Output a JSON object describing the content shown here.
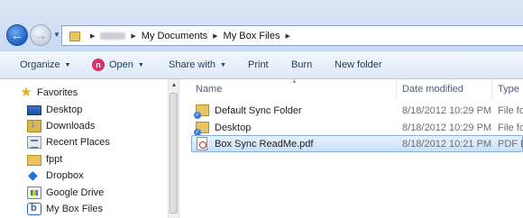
{
  "address": {
    "breadcrumbs": [
      "My Documents",
      "My Box Files"
    ]
  },
  "toolbar": {
    "organize": "Organize",
    "open": "Open",
    "share_with": "Share with",
    "print": "Print",
    "burn": "Burn",
    "new_folder": "New folder"
  },
  "nav": {
    "favorites": "Favorites",
    "items": [
      {
        "label": "Desktop",
        "icon": "desktop-icon"
      },
      {
        "label": "Downloads",
        "icon": "downloads-icon"
      },
      {
        "label": "Recent Places",
        "icon": "recent-places-icon"
      },
      {
        "label": "fppt",
        "icon": "folder-icon"
      },
      {
        "label": "Dropbox",
        "icon": "dropbox-icon"
      },
      {
        "label": "Google Drive",
        "icon": "google-drive-icon"
      },
      {
        "label": "My Box Files",
        "icon": "box-icon"
      }
    ]
  },
  "columns": {
    "name": "Name",
    "date_modified": "Date modified",
    "type": "Type"
  },
  "files": [
    {
      "name": "Default Sync Folder",
      "date": "8/18/2012 10:29 PM",
      "type": "File fo",
      "icon": "synced-folder-icon",
      "selected": false
    },
    {
      "name": "Desktop",
      "date": "8/18/2012 10:29 PM",
      "type": "File fo",
      "icon": "synced-folder-icon",
      "selected": false
    },
    {
      "name": "Box Sync ReadMe.pdf",
      "date": "8/18/2012 10:21 PM",
      "type": "PDF D",
      "icon": "pdf-icon",
      "selected": true
    }
  ],
  "colors": {
    "selection_border": "#84acdd",
    "command_text": "#1e395b",
    "accent": "#1c5fbf"
  }
}
